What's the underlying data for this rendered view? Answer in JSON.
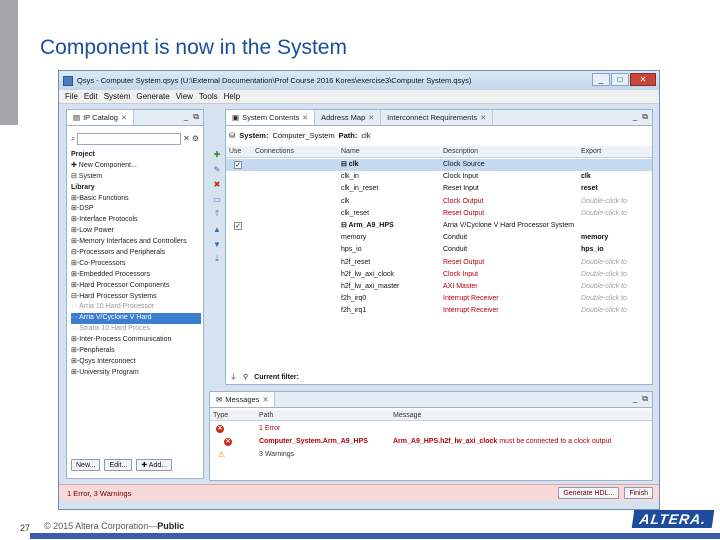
{
  "slide": {
    "title": "Component is now in the System",
    "number": "27",
    "footer_copyright": "© 2015 Altera Corporation—",
    "footer_public": "Public",
    "logo": "ALTERA."
  },
  "window": {
    "title": "Qsys - Computer System.qsys (U:\\External Documentation\\Prof Course 2016 Kores\\exercise3\\Computer System.qsys)",
    "buttons": {
      "minimize": "_",
      "maximize": "□",
      "close": "✕"
    }
  },
  "menu": [
    "File",
    "Edit",
    "System",
    "Generate",
    "View",
    "Tools",
    "Help"
  ],
  "ip_catalog": {
    "tab_label": "IP Catalog",
    "tree": [
      {
        "label": "Project",
        "cls": "bold"
      },
      {
        "label": "  ✚ New Component...",
        "cls": ""
      },
      {
        "label": "⊟ System",
        "cls": ""
      },
      {
        "label": "Library",
        "cls": "bold"
      },
      {
        "label": "⊞-Basic Functions",
        "cls": ""
      },
      {
        "label": "⊞-DSP",
        "cls": ""
      },
      {
        "label": "⊞-Interface Protocols",
        "cls": ""
      },
      {
        "label": "⊞-Low Power",
        "cls": ""
      },
      {
        "label": "⊞-Memory Interfaces and Controllers",
        "cls": ""
      },
      {
        "label": "⊟-Processors and Peripherals",
        "cls": ""
      },
      {
        "label": "   ⊞-Co-Processors",
        "cls": ""
      },
      {
        "label": "   ⊞-Embedded Processors",
        "cls": ""
      },
      {
        "label": "   ⊞-Hard Processor Components",
        "cls": ""
      },
      {
        "label": "   ⊟-Hard Processor Systems",
        "cls": ""
      },
      {
        "label": "      · · Arria 10 Hard Processor",
        "cls": "faded"
      },
      {
        "label": "      · · Arria V/Cyclone V Hard",
        "cls": "sel"
      },
      {
        "label": "      · · Stratix 10 Hard Proces",
        "cls": "faded"
      },
      {
        "label": "   ⊞-Inter-Process Communication",
        "cls": ""
      },
      {
        "label": "   ⊞-Peripherals",
        "cls": ""
      },
      {
        "label": "⊞-Qsys Interconnect",
        "cls": ""
      },
      {
        "label": "⊞-University Program",
        "cls": ""
      }
    ],
    "buttons": {
      "new": "New...",
      "edit": "Edit...",
      "add": "✚ Add..."
    }
  },
  "system_contents": {
    "tabs": [
      "System Contents",
      "Address Map",
      "Interconnect Requirements"
    ],
    "system_label": "System:",
    "system_name": "Computer_System",
    "path_label": "Path:",
    "path_value": "clk",
    "columns": [
      "Use",
      "Connections",
      "Name",
      "Description",
      "Export"
    ],
    "rows": [
      {
        "use": "✓",
        "name": "⊟ clk",
        "name_bold": true,
        "desc": "Clock Source",
        "desc_red": false,
        "export": "",
        "export_hint": false,
        "sel": true
      },
      {
        "use": "",
        "name": "   clk_in",
        "name_bold": false,
        "desc": "Clock Input",
        "desc_red": false,
        "export": "clk",
        "export_hint": false,
        "sel": false
      },
      {
        "use": "",
        "name": "   clk_in_reset",
        "name_bold": false,
        "desc": "Reset Input",
        "desc_red": false,
        "export": "reset",
        "export_hint": false,
        "sel": false
      },
      {
        "use": "",
        "name": "   clk",
        "name_bold": false,
        "desc": "Clock Output",
        "desc_red": true,
        "export": "Double-click to",
        "export_hint": true,
        "sel": false
      },
      {
        "use": "",
        "name": "   clk_reset",
        "name_bold": false,
        "desc": "Reset Output",
        "desc_red": true,
        "export": "Double-click to",
        "export_hint": true,
        "sel": false
      },
      {
        "use": "✓",
        "name": "⊟ Arm_A9_HPS",
        "name_bold": true,
        "desc": "Arria V/Cyclone V Hard Processor System",
        "desc_red": false,
        "export": "",
        "export_hint": false,
        "sel": false
      },
      {
        "use": "",
        "name": "   memory",
        "name_bold": false,
        "desc": "Conduit",
        "desc_red": false,
        "export": "memory",
        "export_hint": false,
        "sel": false
      },
      {
        "use": "",
        "name": "   hps_io",
        "name_bold": false,
        "desc": "Conduit",
        "desc_red": false,
        "export": "hps_io",
        "export_hint": false,
        "sel": false
      },
      {
        "use": "",
        "name": "   h2f_reset",
        "name_bold": false,
        "desc": "Reset Output",
        "desc_red": true,
        "export": "Double-click to",
        "export_hint": true,
        "sel": false
      },
      {
        "use": "",
        "name": "   h2f_lw_axi_clock",
        "name_bold": false,
        "desc": "Clock Input",
        "desc_red": true,
        "export": "Double-click to",
        "export_hint": true,
        "sel": false
      },
      {
        "use": "",
        "name": "   h2f_lw_axi_master",
        "name_bold": false,
        "desc": "AXI Master",
        "desc_red": true,
        "export": "Double-click to",
        "export_hint": true,
        "sel": false
      },
      {
        "use": "",
        "name": "   f2h_irq0",
        "name_bold": false,
        "desc": "Interrupt Receiver",
        "desc_red": true,
        "export": "Double-click to",
        "export_hint": true,
        "sel": false
      },
      {
        "use": "",
        "name": "   f2h_irq1",
        "name_bold": false,
        "desc": "Interrupt Receiver",
        "desc_red": true,
        "export": "Double-click to",
        "export_hint": true,
        "sel": false
      }
    ],
    "current_filter": "Current filter:"
  },
  "messages": {
    "tab_label": "Messages",
    "columns": [
      "Type",
      "Path",
      "Message"
    ],
    "rows": [
      {
        "indent": false,
        "path": "1 Error",
        "path_bold": false,
        "message": "",
        "msg_bold": ""
      },
      {
        "indent": true,
        "path": "Computer_System.Arm_A9_HPS",
        "path_bold": true,
        "message": " must be connected to a clock output",
        "msg_bold": "Arm_A9_HPS.h2f_lw_axi_clock"
      },
      {
        "indent": false,
        "path": "3 Warnings",
        "path_bold": false,
        "message": "",
        "msg_bold": ""
      }
    ]
  },
  "status_bar": {
    "text": "1 Error, 3 Warnings",
    "generate": "Generate HDL...",
    "finish": "Finish"
  },
  "colors": {
    "accent": "#1a4fa0",
    "selected": "#3b7fd1",
    "error": "#c8281e",
    "status_bg": "#f8d9d9"
  }
}
